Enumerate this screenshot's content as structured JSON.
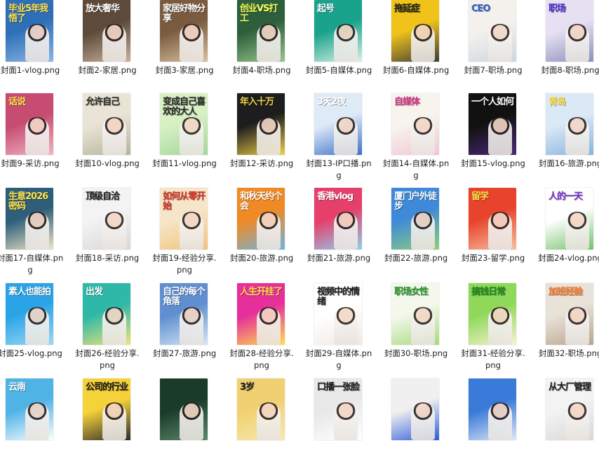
{
  "files": [
    {
      "name": "封面1-vlog.png",
      "thumb_text": "毕业5年我悟了",
      "bg": [
        "#2f6fb8",
        "#8db7e6"
      ],
      "accent": "#ffe14a"
    },
    {
      "name": "封面2-家居.png",
      "thumb_text": "放大奢华",
      "bg": [
        "#5e4a3a",
        "#c9b29a"
      ],
      "accent": "#ffffff"
    },
    {
      "name": "封面3-家居.png",
      "thumb_text": "家居好物分享",
      "bg": [
        "#7a5b3f",
        "#d8c1a0"
      ],
      "accent": "#ffffff"
    },
    {
      "name": "封面4-职场.png",
      "thumb_text": "创业VS打工",
      "bg": [
        "#2e5f3c",
        "#9cc58e"
      ],
      "accent": "#f6ff5a"
    },
    {
      "name": "封面5-自媒体.png",
      "thumb_text": "起号",
      "bg": [
        "#1aa38c",
        "#d9f3e6"
      ],
      "accent": "#ffffff"
    },
    {
      "name": "封面6-自媒体.png",
      "thumb_text": "拖延症",
      "bg": [
        "#f0c21a",
        "#3b3b3b"
      ],
      "accent": "#1a1a1a"
    },
    {
      "name": "封面7-职场.png",
      "thumb_text": "CEO",
      "bg": [
        "#f4f1ec",
        "#cdd6e1"
      ],
      "accent": "#3364c8"
    },
    {
      "name": "封面8-职场.png",
      "thumb_text": "职场",
      "bg": [
        "#e6e0f2",
        "#8a8fbf"
      ],
      "accent": "#4a2fd1"
    },
    {
      "name": "封面9-采访.png",
      "thumb_text": "话说",
      "bg": [
        "#c64c72",
        "#f1b6c3"
      ],
      "accent": "#ffe14a"
    },
    {
      "name": "封面10-vlog.png",
      "thumb_text": "允许自己",
      "bg": [
        "#e9e4d5",
        "#b6b39a"
      ],
      "accent": "#2a2a2a"
    },
    {
      "name": "封面11-vlog.png",
      "thumb_text": "变成自己喜欢的大人",
      "bg": [
        "#d7f0c4",
        "#a3d69a"
      ],
      "accent": "#2a2a2a"
    },
    {
      "name": "封面12-采访.png",
      "thumb_text": "年入十万",
      "bg": [
        "#1d1d1d",
        "#f0d24a"
      ],
      "accent": "#f0d24a"
    },
    {
      "name": "封面13-IP口播.png",
      "thumb_text": "3天2夜",
      "bg": [
        "#dfeaf7",
        "#3b6fc7"
      ],
      "accent": "#ffffff"
    },
    {
      "name": "封面14-自媒体.png",
      "thumb_text": "自媒体",
      "bg": [
        "#f7f4ee",
        "#f1c6d3"
      ],
      "accent": "#d63384"
    },
    {
      "name": "封面15-vlog.png",
      "thumb_text": "一个人如何",
      "bg": [
        "#111111",
        "#4a2a7a"
      ],
      "accent": "#ffffff"
    },
    {
      "name": "封面16-旅游.png",
      "thumb_text": "青岛",
      "bg": [
        "#dbe9f6",
        "#86b4dc"
      ],
      "accent": "#ffe14a"
    },
    {
      "name": "封面17-自媒体.png",
      "thumb_text": "生意2026密码",
      "bg": [
        "#2f5e7a",
        "#f0e6c8"
      ],
      "accent": "#ffe14a"
    },
    {
      "name": "封面18-采访.png",
      "thumb_text": "顶级自洽",
      "bg": [
        "#f3f3f3",
        "#d8d8d8"
      ],
      "accent": "#1a1a1a"
    },
    {
      "name": "封面19-经验分享.png",
      "thumb_text": "如何从零开始",
      "bg": [
        "#f6e6c9",
        "#f0c47a"
      ],
      "accent": "#d6301f"
    },
    {
      "name": "封面20-旅游.png",
      "thumb_text": "和秋天约个会",
      "bg": [
        "#f08a24",
        "#6fb4dc"
      ],
      "accent": "#ffffff"
    },
    {
      "name": "封面21-旅游.png",
      "thumb_text": "香港vlog",
      "bg": [
        "#e63f6b",
        "#8ed2f0"
      ],
      "accent": "#ffffff"
    },
    {
      "name": "封面22-旅游.png",
      "thumb_text": "厦门户外徒步",
      "bg": [
        "#3f8ad8",
        "#8fd07a"
      ],
      "accent": "#ffffff"
    },
    {
      "name": "封面23-留学.png",
      "thumb_text": "留学",
      "bg": [
        "#e8442d",
        "#f5c2a0"
      ],
      "accent": "#ffe14a"
    },
    {
      "name": "封面24-vlog.png",
      "thumb_text": "人的一天",
      "bg": [
        "#ffffff",
        "#73c16a"
      ],
      "accent": "#7a2fd1"
    },
    {
      "name": "封面25-vlog.png",
      "thumb_text": "素人也能拍",
      "bg": [
        "#2aa4e6",
        "#9bd9f4"
      ],
      "accent": "#ffffff"
    },
    {
      "name": "封面26-经验分享.png",
      "thumb_text": "出发",
      "bg": [
        "#2fb8a8",
        "#f3e27a"
      ],
      "accent": "#ffffff"
    },
    {
      "name": "封面27-旅游.png",
      "thumb_text": "自己的每个角落",
      "bg": [
        "#5f8fd0",
        "#d7e6f6"
      ],
      "accent": "#ffffff"
    },
    {
      "name": "封面28-经验分享.png",
      "thumb_text": "人生开挂了",
      "bg": [
        "#e62f9a",
        "#ffe14a"
      ],
      "accent": "#ffe14a"
    },
    {
      "name": "封面29-自媒体.png",
      "thumb_text": "视频中的情绪",
      "bg": [
        "#ffffff",
        "#f1e9e1"
      ],
      "accent": "#1a1a1a"
    },
    {
      "name": "封面30-职场.png",
      "thumb_text": "职场女性",
      "bg": [
        "#f4f8ec",
        "#a7d97a"
      ],
      "accent": "#2a9a2a"
    },
    {
      "name": "封面31-经验分享.png",
      "thumb_text": "搞钱日常",
      "bg": [
        "#8fd85a",
        "#f8f2d0"
      ],
      "accent": "#1f8a1f"
    },
    {
      "name": "封面32-职场.png",
      "thumb_text": "加班经验",
      "bg": [
        "#e9e2d8",
        "#b7a48e"
      ],
      "accent": "#ff7a2a"
    },
    {
      "name": "",
      "thumb_text": "云南",
      "bg": [
        "#4fb3e6",
        "#ffffff"
      ],
      "accent": "#ffffff"
    },
    {
      "name": "",
      "thumb_text": "公司的行业",
      "bg": [
        "#f6d23a",
        "#2a2a2a"
      ],
      "accent": "#1a1a1a"
    },
    {
      "name": "",
      "thumb_text": "",
      "bg": [
        "#1a3a2a",
        "#5a8a6a"
      ],
      "accent": "#ffffff"
    },
    {
      "name": "",
      "thumb_text": "3岁",
      "bg": [
        "#f0d070",
        "#f8e8b0"
      ],
      "accent": "#1a1a1a"
    },
    {
      "name": "",
      "thumb_text": "口播一张脸",
      "bg": [
        "#e8e8e8",
        "#ffffff"
      ],
      "accent": "#1a1a1a"
    },
    {
      "name": "",
      "thumb_text": "",
      "bg": [
        "#f0f0f0",
        "#2a5ad8"
      ],
      "accent": "#2a5ad8"
    },
    {
      "name": "",
      "thumb_text": "",
      "bg": [
        "#3a7ad8",
        "#dfe9f6"
      ],
      "accent": "#ffffff"
    },
    {
      "name": "",
      "thumb_text": "从大厂管理",
      "bg": [
        "#f3f3f3",
        "#d8d8d8"
      ],
      "accent": "#1a1a1a"
    }
  ]
}
